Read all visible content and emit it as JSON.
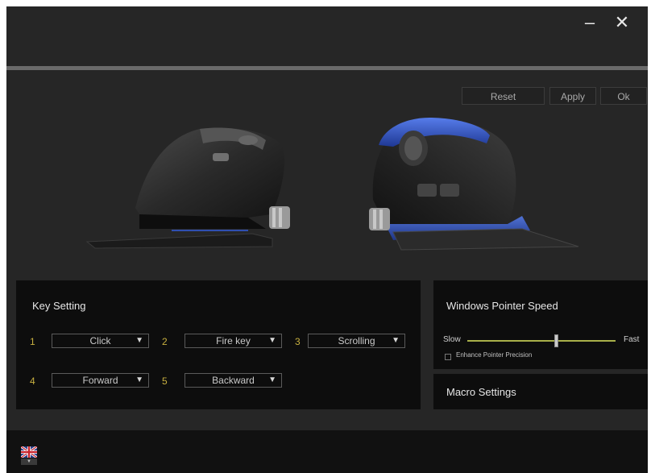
{
  "window": {
    "minimize_label": "–",
    "close_label": "✕"
  },
  "toolbar": {
    "reset_label": "Reset",
    "apply_label": "Apply",
    "ok_label": "Ok"
  },
  "key_setting": {
    "title": "Key Setting",
    "keys": [
      {
        "number": "1",
        "value": "Click"
      },
      {
        "number": "2",
        "value": "Fire key"
      },
      {
        "number": "3",
        "value": "Scrolling"
      },
      {
        "number": "4",
        "value": "Forward"
      },
      {
        "number": "5",
        "value": "Backward"
      }
    ],
    "dropdown_arrow": "▼"
  },
  "pointer_speed": {
    "title": "Windows Pointer Speed",
    "slow_label": "Slow",
    "fast_label": "Fast",
    "slider_fraction": 0.6,
    "checkbox_label": "Enhance Pointer Precision",
    "checkbox_checked": false
  },
  "macro": {
    "title": "Macro Settings"
  },
  "language": {
    "icon": "uk-flag-icon"
  },
  "colors": {
    "accent_number": "#c8b040",
    "slider_track": "#a9b04a",
    "mouse_glow": "#3a63e0"
  }
}
